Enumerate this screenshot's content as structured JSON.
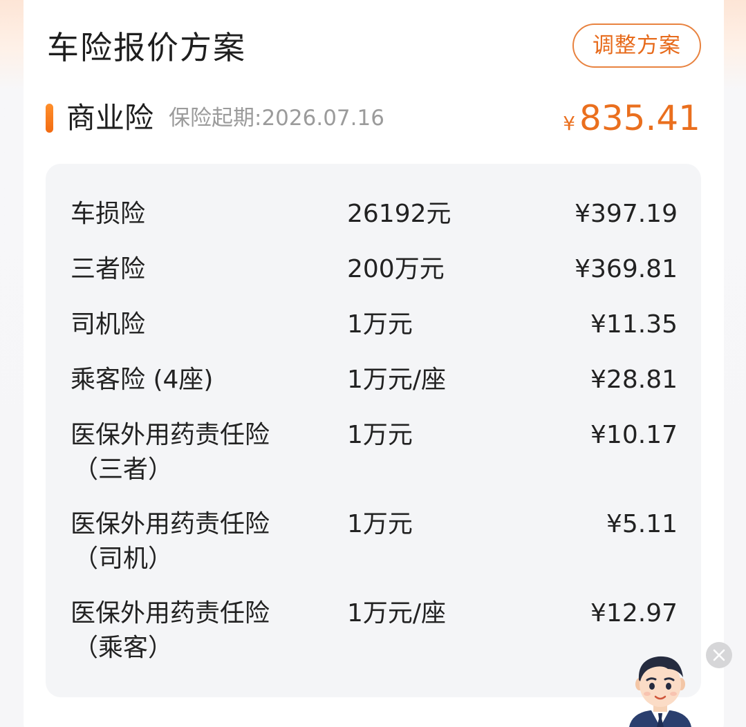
{
  "header": {
    "title": "车险报价方案",
    "adjust_button": "调整方案"
  },
  "section": {
    "title": "商业险",
    "start_date": "保险起期:2026.07.16",
    "currency": "¥",
    "total": "835.41"
  },
  "items": [
    {
      "name": "车损险",
      "name_sub": "",
      "coverage": "26192元",
      "price": "¥397.19"
    },
    {
      "name": "三者险",
      "name_sub": "",
      "coverage": "200万元",
      "price": "¥369.81"
    },
    {
      "name": "司机险",
      "name_sub": "",
      "coverage": "1万元",
      "price": "¥11.35"
    },
    {
      "name": "乘客险 (4座)",
      "name_sub": "",
      "coverage": "1万元/座",
      "price": "¥28.81"
    },
    {
      "name": "医保外用药责任险",
      "name_sub": "（三者）",
      "coverage": "1万元",
      "price": "¥10.17"
    },
    {
      "name": "医保外用药责任险",
      "name_sub": "（司机）",
      "coverage": "1万元",
      "price": "¥5.11"
    },
    {
      "name": "医保外用药责任险",
      "name_sub": "（乘客）",
      "coverage": "1万元/座",
      "price": "¥12.97"
    }
  ],
  "floating": {
    "close_icon": "close-icon",
    "avatar_icon": "agent-avatar"
  },
  "colors": {
    "accent": "#ea6f1e",
    "text": "#222222",
    "muted": "#9b9b9b",
    "panel": "#f4f5f7"
  }
}
